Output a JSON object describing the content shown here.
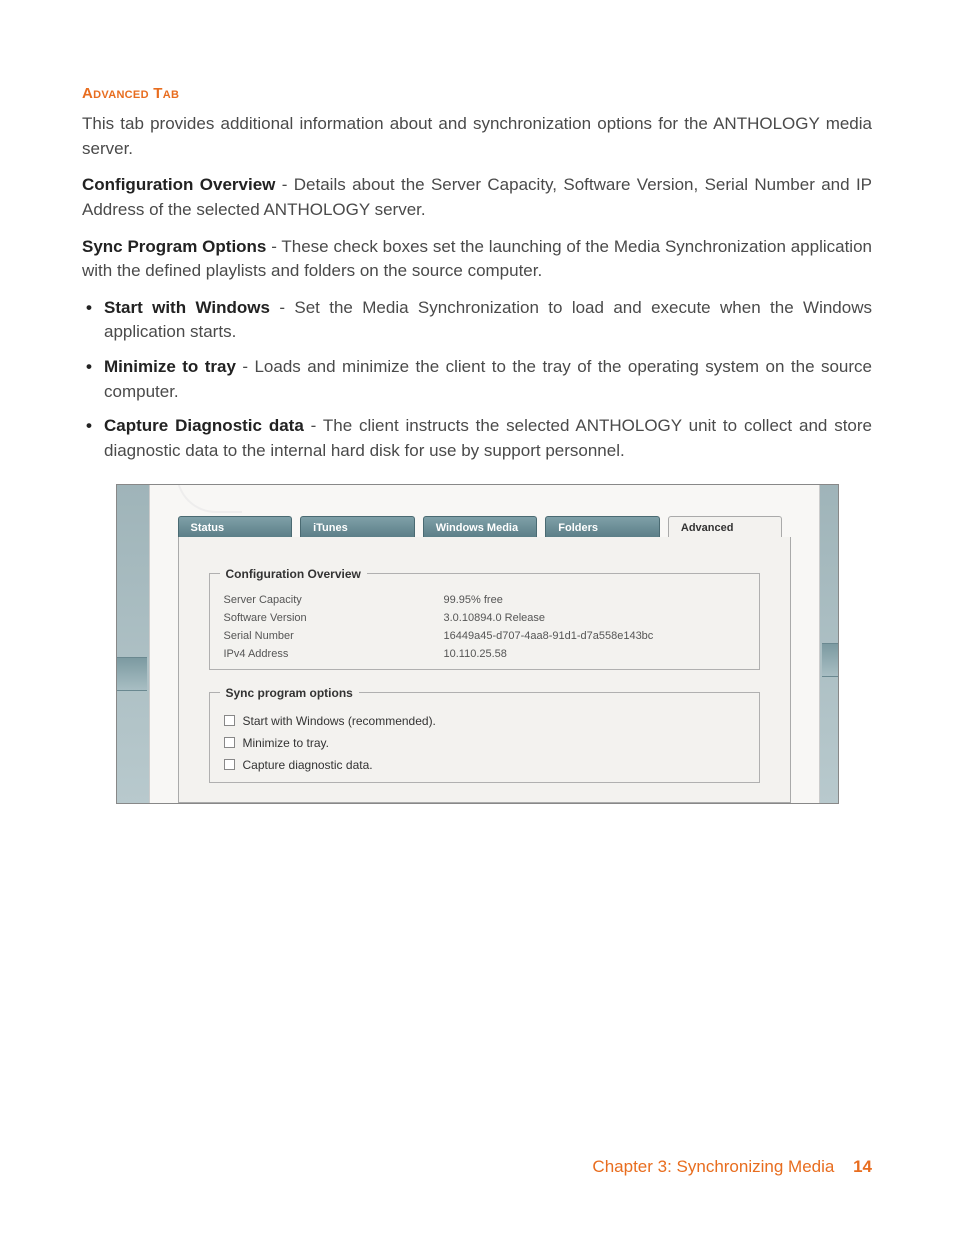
{
  "heading": "Advanced Tab",
  "intro": "This tab provides additional information about and synchronization options for the ANTHOLOGY media server.",
  "config_overview": {
    "label": "Configuration Overview",
    "text": " - Details about the Server Capacity, Software Version, Serial Number and IP Address of the selected ANTHOLOGY server."
  },
  "sync_options": {
    "label": "Sync Program Options",
    "text": " - These check boxes set the launching of the Media Synchronization application with the defined playlists and folders on the source computer."
  },
  "bullets": [
    {
      "label": "Start with Windows",
      "text": " - Set the Media Synchronization to load and execute when the Windows application starts."
    },
    {
      "label": "Minimize to tray",
      "text": " - Loads and minimize the client to the tray of the operating system on the source computer."
    },
    {
      "label": "Capture Diagnostic data",
      "text": " - The client instructs the selected ANTHOLOGY unit to collect and store diagnostic data to the internal hard disk for use by support personnel."
    }
  ],
  "screenshot": {
    "tabs": [
      "Status",
      "iTunes",
      "Windows Media",
      "Folders",
      "Advanced"
    ],
    "active_tab": "Advanced",
    "group1_title": "Configuration Overview",
    "rows": [
      {
        "label": "Server Capacity",
        "value": "99.95% free"
      },
      {
        "label": "Software Version",
        "value": "3.0.10894.0 Release"
      },
      {
        "label": "Serial Number",
        "value": "16449a45-d707-4aa8-91d1-d7a558e143bc"
      },
      {
        "label": "IPv4 Address",
        "value": "10.110.25.58"
      }
    ],
    "group2_title": "Sync program options",
    "checks": [
      "Start with Windows (recommended).",
      "Minimize to tray.",
      "Capture diagnostic data."
    ]
  },
  "footer": {
    "chapter": "Chapter 3: Synchronizing Media",
    "page": "14"
  }
}
